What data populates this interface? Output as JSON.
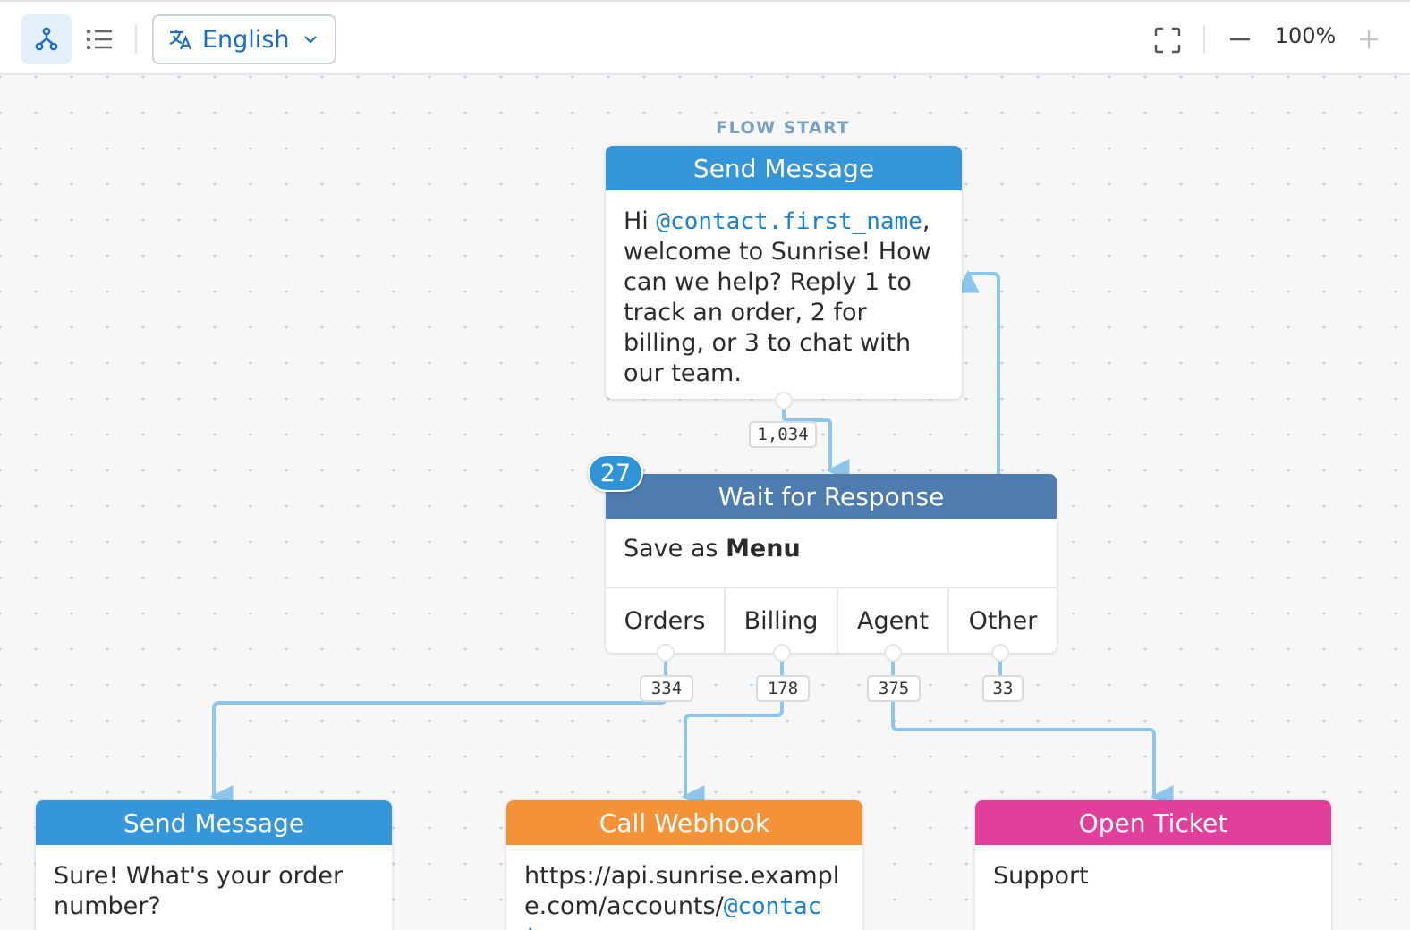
{
  "toolbar": {
    "flow_view_icon": "flow-tree-icon",
    "list_view_icon": "list-icon",
    "language": {
      "selected": "English",
      "icon": "translate-icon"
    },
    "fullscreen_icon": "fullscreen-icon",
    "zoom": {
      "level": "100%",
      "minus": "−",
      "plus": "+"
    }
  },
  "canvas": {
    "flow_start_label": "FLOW START",
    "start_node": {
      "type": "Send Message",
      "text_prefix": "Hi ",
      "variable": "@contact.first_name",
      "text_suffix": ", welcome to Sunrise! How can we help? Reply 1 to track an order, 2 for billing, or 3 to chat with our team.",
      "exit_count": "1,034"
    },
    "wait_node": {
      "type": "Wait for Response",
      "active_count": "27",
      "save_prefix": "Save as ",
      "save_name": "Menu",
      "cases": [
        {
          "label": "Orders",
          "count": "334"
        },
        {
          "label": "Billing",
          "count": "178"
        },
        {
          "label": "Agent",
          "count": "375"
        },
        {
          "label": "Other",
          "count": "33"
        }
      ]
    },
    "order_node": {
      "type": "Send Message",
      "text": "Sure! What's your order number?"
    },
    "webhook_node": {
      "type": "Call Webhook",
      "url_prefix": "https://api.sunrise.example.com/accounts/",
      "url_variable": "@contact."
    },
    "ticket_node": {
      "type": "Open Ticket",
      "topic": "Support"
    }
  },
  "colors": {
    "send_message": "#3597da",
    "wait_for_response": "#4e7caf",
    "call_webhook": "#f49237",
    "open_ticket": "#e13f9c",
    "edge": "#8cc6ec"
  }
}
